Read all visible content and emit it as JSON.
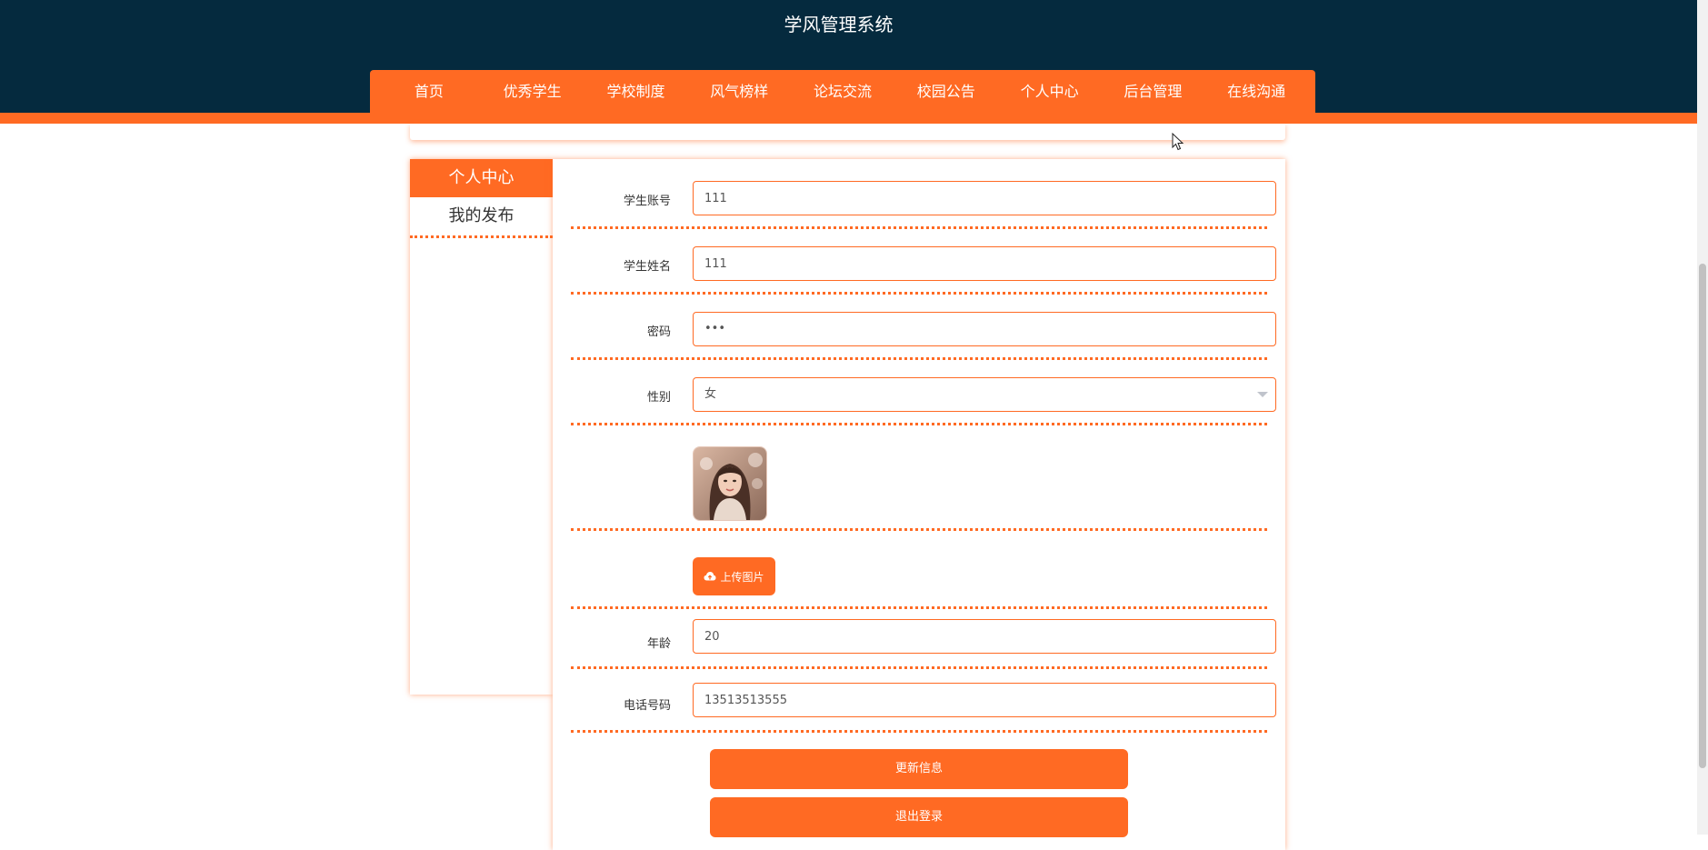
{
  "site": {
    "title": "学风管理系统"
  },
  "nav": {
    "items": [
      {
        "label": "首页"
      },
      {
        "label": "优秀学生"
      },
      {
        "label": "学校制度"
      },
      {
        "label": "风气榜样"
      },
      {
        "label": "论坛交流"
      },
      {
        "label": "校园公告"
      },
      {
        "label": "个人中心"
      },
      {
        "label": "后台管理"
      },
      {
        "label": "在线沟通"
      }
    ]
  },
  "sidebar": {
    "header": "个人中心",
    "items": [
      {
        "label": "我的发布"
      }
    ]
  },
  "form": {
    "account": {
      "label": "学生账号",
      "value": "111"
    },
    "name": {
      "label": "学生姓名",
      "value": "111"
    },
    "password": {
      "label": "密码",
      "value": "•••"
    },
    "gender": {
      "label": "性别",
      "value": "女"
    },
    "upload": {
      "label": "上传图片",
      "icon": "cloud-upload-icon"
    },
    "age": {
      "label": "年龄",
      "value": "20"
    },
    "phone": {
      "label": "电话号码",
      "value": "13513513555"
    }
  },
  "actions": {
    "update": "更新信息",
    "logout": "退出登录"
  },
  "colors": {
    "header_bg": "#052a3e",
    "accent": "#ff6a23"
  }
}
